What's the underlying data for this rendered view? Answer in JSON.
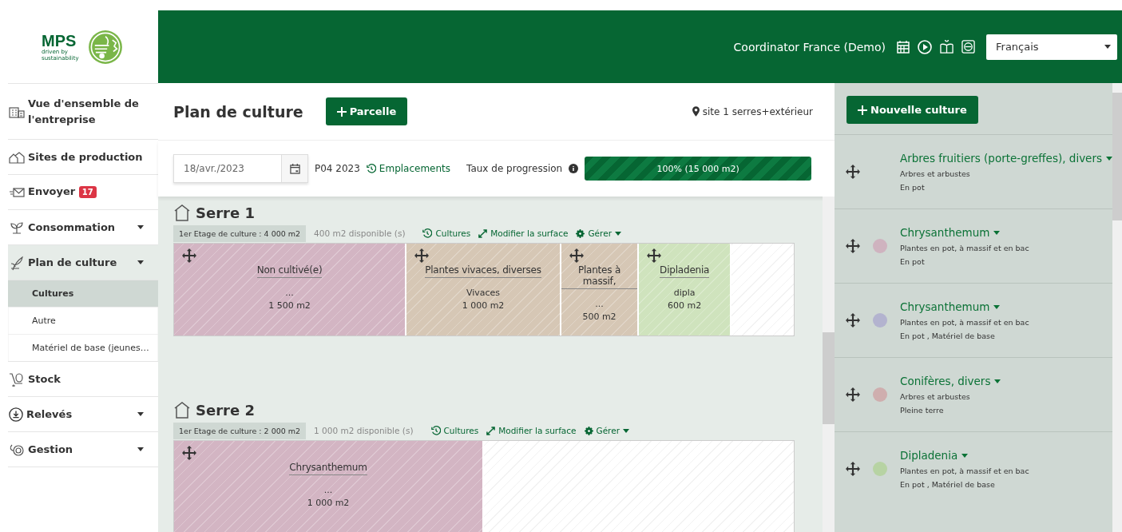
{
  "logo": {
    "name": "MPS",
    "tagline": "driven by sustainability"
  },
  "header": {
    "user": "Coordinator France (Demo)",
    "language": "Français"
  },
  "sidebar": {
    "items": [
      {
        "label": "Vue d'ensemble de l'entreprise",
        "selected": false
      },
      {
        "label": "Sites de production",
        "selected": false
      },
      {
        "label": "Envoyer",
        "badge": "17",
        "selected": false
      },
      {
        "label": "Consommation",
        "selected": false,
        "has_menu": true
      },
      {
        "label": "Plan de culture",
        "selected": true,
        "has_menu": true,
        "children": [
          {
            "label": "Cultures",
            "selected": true
          },
          {
            "label": "Autre",
            "selected": false
          },
          {
            "label": "Matériel de base (jeunes…",
            "selected": false
          }
        ]
      },
      {
        "label": "Stock",
        "selected": false
      },
      {
        "label": "Relevés",
        "selected": false,
        "has_menu": true
      },
      {
        "label": "Gestion",
        "selected": false,
        "has_menu": true
      }
    ]
  },
  "page": {
    "title": "Plan de culture",
    "add_button": "Parcelle",
    "site": "site 1 serres+extérieur"
  },
  "toolbar": {
    "date": "18/avr./2023",
    "period": "P04 2023",
    "locations_link": "Emplacements",
    "progress_label": "Taux de progression",
    "progress": {
      "level": 1,
      "reading": "100% (15 000 m2)"
    }
  },
  "greenhouses": [
    {
      "name": "Serre 1",
      "floor": "1er Etage de culture : 4 000 m2",
      "available": "400 m2 disponible (s)",
      "links": [
        "Cultures",
        "Modifier la surface",
        "Gérer"
      ],
      "plots": [
        {
          "name": "Non cultivé(e)",
          "note": "...",
          "area": "1 500 m2",
          "color": "#d3b5c3"
        },
        {
          "name": "Plantes vivaces, diverses",
          "note": "Vivaces",
          "area": "1 000 m2",
          "color": "#d6c7b5"
        },
        {
          "name": "Plantes à massif,",
          "note": "...",
          "area": "500 m2",
          "color": "#d6c7b5"
        },
        {
          "name": "Dipladenia",
          "note": "dipla",
          "area": "600 m2",
          "color": "#cfe3bd"
        }
      ]
    },
    {
      "name": "Serre 2",
      "floor": "1er Etage de culture : 2 000 m2",
      "available": "1 000 m2 disponible (s)",
      "links": [
        "Cultures",
        "Modifier la surface",
        "Gérer"
      ],
      "plots": [
        {
          "name": "Chrysanthemum",
          "note": "...",
          "area": "1 000 m2",
          "color": "#d3b5c3"
        }
      ]
    }
  ],
  "cultures_panel": {
    "add_button": "Nouvelle culture",
    "items": [
      {
        "name": "Arbres fruitiers (porte-greffes), divers",
        "type": "Arbres et arbustes",
        "details": "En pot"
      },
      {
        "name": "Chrysanthemum",
        "type": "Plantes en pot, à massif et en bac",
        "details": "En pot",
        "color": "#cfb3bf"
      },
      {
        "name": "Chrysanthemum",
        "type": "Plantes en pot, à massif et en bac",
        "details": "En pot , Matériel de base",
        "color": "#b3b3cf"
      },
      {
        "name": "Conifères, divers",
        "type": "Arbres et arbustes",
        "details": "Pleine terre",
        "color": "#cfaeae"
      },
      {
        "name": "Dipladenia",
        "type": "Plantes en pot, à massif et en bac",
        "details": "En pot , Matériel de base",
        "color": "#b7d3a3"
      }
    ]
  }
}
